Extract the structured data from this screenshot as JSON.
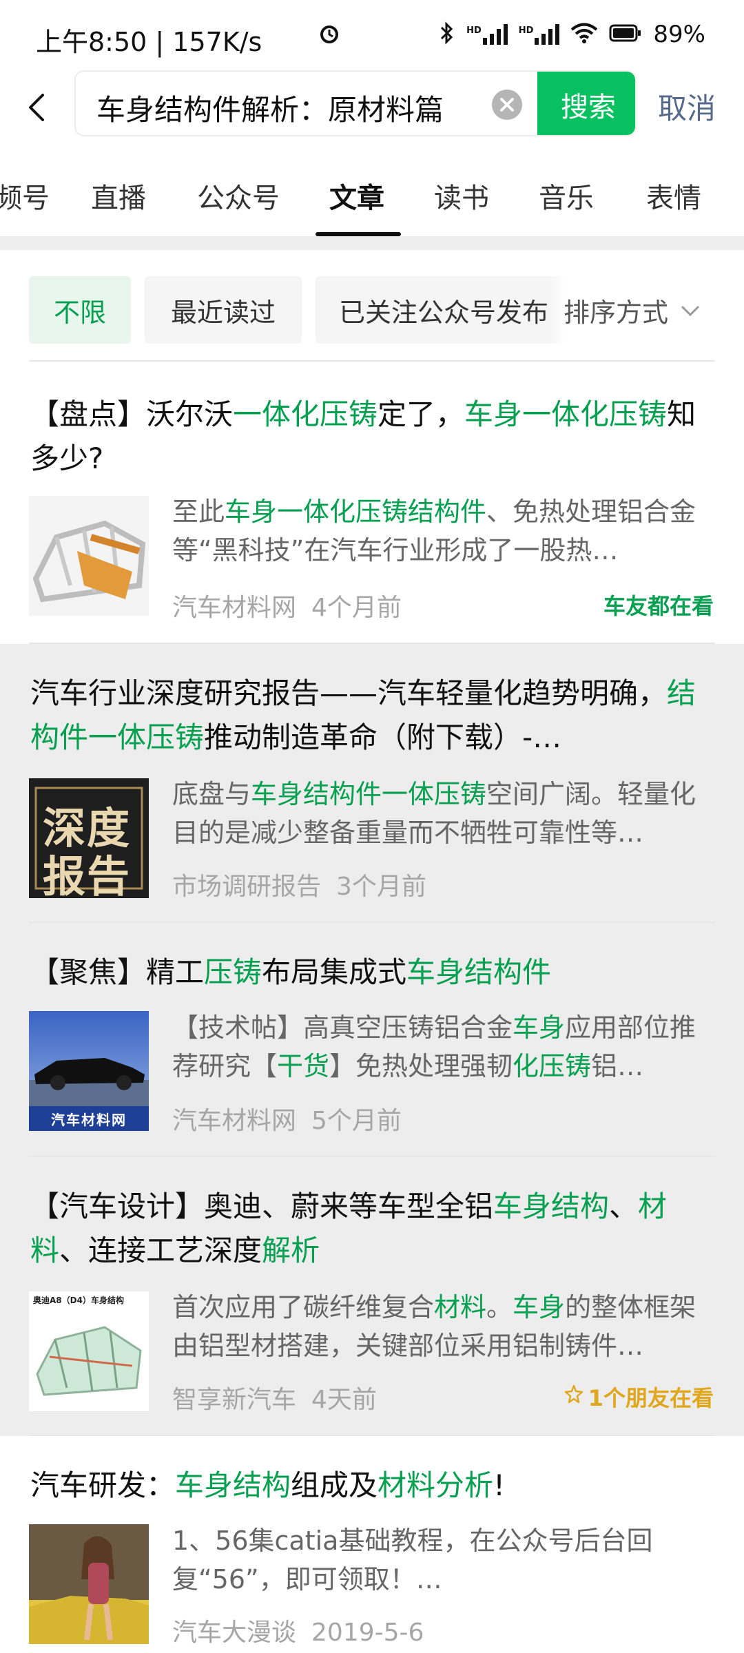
{
  "status_bar": {
    "time": "上午8:50 | 157K/s",
    "battery": "89%",
    "network_tags": [
      "HD",
      "HD"
    ]
  },
  "search": {
    "query": "车身结构件解析：原材料篇",
    "search_label": "搜索",
    "cancel_label": "取消"
  },
  "tabs": [
    {
      "label": "频号"
    },
    {
      "label": "直播"
    },
    {
      "label": "公众号"
    },
    {
      "label": "文章"
    },
    {
      "label": "读书"
    },
    {
      "label": "音乐"
    },
    {
      "label": "表情"
    }
  ],
  "active_tab": "文章",
  "filters": {
    "chips": [
      {
        "label": "不限"
      },
      {
        "label": "最近读过"
      },
      {
        "label": "已关注公众号发布"
      }
    ],
    "sort_label": "排序方式"
  },
  "results": [
    {
      "title_parts": [
        {
          "t": "【盘点】沃尔沃"
        },
        {
          "t": "一体化压铸",
          "hl": true
        },
        {
          "t": "定了，"
        },
        {
          "t": "车身一体化压铸",
          "hl": true
        },
        {
          "t": "知多少?"
        }
      ],
      "desc_parts": [
        {
          "t": "至此"
        },
        {
          "t": "车身一体化压铸结构件",
          "hl": true
        },
        {
          "t": "、免热处理铝合金等“黑科技”在汽车行业形成了一股热…"
        }
      ],
      "source": "汽车材料网",
      "time": "4个月前",
      "badge": "车友都在看",
      "badge_color": "#07a050",
      "thumb": "car-body-frame-image",
      "bg": "#ffffff"
    },
    {
      "title_parts": [
        {
          "t": "汽车行业深度研究报告——汽车轻量化趋势明确，"
        },
        {
          "t": "结构件一体压铸",
          "hl": true
        },
        {
          "t": "推动制造革命（附下载）-…"
        }
      ],
      "desc_parts": [
        {
          "t": "底盘与"
        },
        {
          "t": "车身结构件一体压铸",
          "hl": true
        },
        {
          "t": "空间广阔。轻量化目的是减少整备重量而不牺牲可靠性等…"
        }
      ],
      "source": "市场调研报告",
      "time": "3个月前",
      "thumb_text": [
        "深度",
        "报告"
      ],
      "thumb": "deep-report-image",
      "bg": "#ededed"
    },
    {
      "title_parts": [
        {
          "t": "【聚焦】精工"
        },
        {
          "t": "压铸",
          "hl": true
        },
        {
          "t": "布局集成式"
        },
        {
          "t": "车身结构件",
          "hl": true
        }
      ],
      "desc_parts": [
        {
          "t": "【技术帖】高真空压铸铝合金"
        },
        {
          "t": "车身",
          "hl": true
        },
        {
          "t": "应用部位推荐研究【"
        },
        {
          "t": "干货",
          "hl": true
        },
        {
          "t": "】免热处理强韧"
        },
        {
          "t": "化压铸",
          "hl": true
        },
        {
          "t": "铝…"
        }
      ],
      "source": "汽车材料网",
      "time": "5个月前",
      "thumb_text": [
        "汽车材料网"
      ],
      "thumb": "black-sedan-image",
      "bg": "#ededed"
    },
    {
      "title_parts": [
        {
          "t": "【汽车设计】奥迪、蔚来等车型全铝"
        },
        {
          "t": "车身结构",
          "hl": true
        },
        {
          "t": "、"
        },
        {
          "t": "材料",
          "hl": true
        },
        {
          "t": "、连接工艺深度"
        },
        {
          "t": "解析",
          "hl": true
        }
      ],
      "desc_parts": [
        {
          "t": "首次应用了碳纤维复合"
        },
        {
          "t": "材料",
          "hl": true
        },
        {
          "t": "。"
        },
        {
          "t": "车身",
          "hl": true
        },
        {
          "t": "的整体框架由铝型材搭建，关键部位采用铝制铸件…"
        }
      ],
      "source": "智享新汽车",
      "time": "4天前",
      "badge": "1个朋友在看",
      "badge_color": "#e0a61c",
      "thumb_text": [
        "奥迪A8（D4）车身结构"
      ],
      "thumb": "audi-body-diagram-image",
      "bg": "#ededed"
    },
    {
      "title_parts": [
        {
          "t": "汽车研发："
        },
        {
          "t": "车身结构",
          "hl": true
        },
        {
          "t": "组成及"
        },
        {
          "t": "材料分析",
          "hl": true
        },
        {
          "t": "!"
        }
      ],
      "desc_parts": [
        {
          "t": "1、56集catia基础教程，在公众号后台回复“56”，即可领取！…"
        }
      ],
      "source": "汽车大漫谈",
      "time": "2019-5-6",
      "thumb": "woman-car-photo-image",
      "bg": "#ffffff"
    }
  ]
}
